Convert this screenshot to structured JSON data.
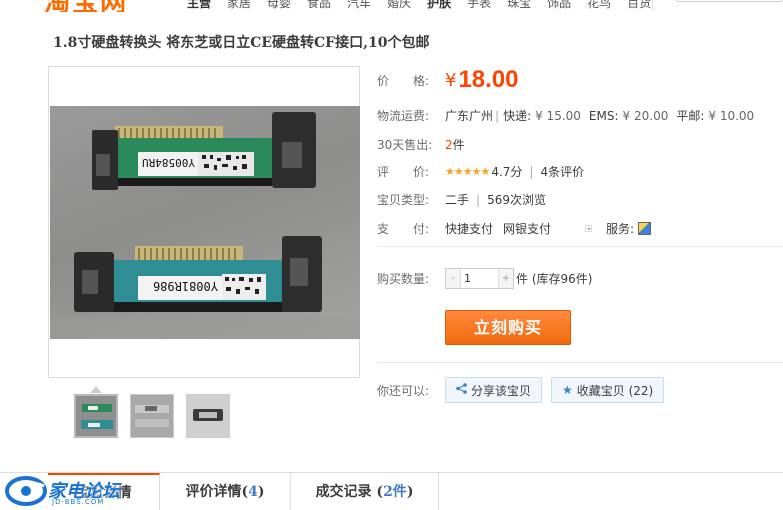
{
  "header": {
    "logo_text": "淘宝网",
    "nav": [
      "主营",
      "家居",
      "母婴",
      "食品",
      "汽车",
      "婚庆",
      "护肤",
      "手表",
      "珠宝",
      "饰品",
      "花鸟",
      "百货"
    ]
  },
  "product": {
    "title": "1.8寸硬盘转换头 将东芝或日立CE硬盘转CF接口,10个包邮",
    "price_label": "价　　格:",
    "currency": "¥",
    "price": "18.00",
    "shipping_label": "物流运费:",
    "shipping_from": "广东广州",
    "express_label": "快递:",
    "express_price": "¥ 15.00",
    "ems_label": "EMS:",
    "ems_price": "¥ 20.00",
    "mail_label": "平邮:",
    "mail_price": "¥ 10.00",
    "sales_label": "30天售出:",
    "sales_count": "2",
    "sales_unit": "件",
    "rating_label": "评　　价:",
    "stars": "★★★★★",
    "rating_score": "4.7分",
    "review_count": "4条评价",
    "type_label": "宝贝类型:",
    "type_value": "二手",
    "views": "569次浏览",
    "payment_label": "支　　付:",
    "payment_1": "快捷支付",
    "payment_2": "网银支付",
    "service_label": "服务:",
    "qty_label": "购买数量:",
    "qty_minus": "-",
    "qty_value": "1",
    "qty_plus": "+",
    "stock_text": "件 (库存96件)",
    "buy_button": "立刻购买",
    "also_label": "你还可以:",
    "share_button": "分享该宝贝",
    "fav_button": "收藏宝贝 (22)",
    "label_top": "Y00584RU",
    "label_bottom": "Y0081R986"
  },
  "tabs": [
    {
      "label": "宝贝详情",
      "count": ""
    },
    {
      "label": "评价详情",
      "count": "4"
    },
    {
      "label": "成交记录",
      "count": "2件"
    }
  ],
  "watermark": {
    "text": "家电论坛",
    "sub": "JD-BBS.COM"
  }
}
